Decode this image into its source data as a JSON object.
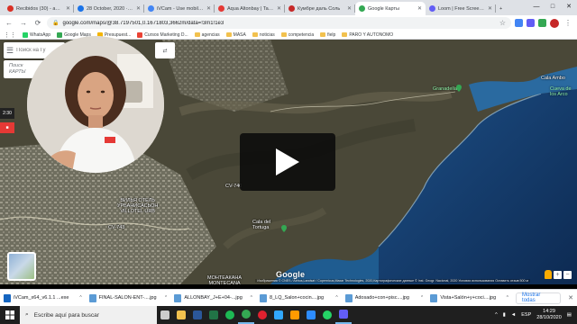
{
  "browser": {
    "tabs": [
      {
        "title": "Recibidos (30) - ama@",
        "color": "#d93025"
      },
      {
        "title": "28 October, 2020 · Lo",
        "color": "#1a73e8"
      },
      {
        "title": "iVCam - Use mobile p",
        "color": "#4285f4"
      },
      {
        "title": "Aqua Altonbay | Tarre",
        "color": "#e53935"
      },
      {
        "title": "Кумбре даль Соль",
        "color": "#c62828"
      },
      {
        "title": "Google Карты",
        "color": "#34a853"
      },
      {
        "title": "Loom | Free Screen &",
        "color": "#625df5"
      }
    ],
    "active_tab": 5,
    "window_controls": [
      "—",
      "□",
      "✕"
    ],
    "url": "google.com/maps/@38.7197501,0.1671803,3662m/data=!3m1!1e3",
    "bookmarks": [
      {
        "label": "WhatsApp",
        "color": "#25d366",
        "kind": "site"
      },
      {
        "label": "Google Maps",
        "color": "#34a853",
        "kind": "site"
      },
      {
        "label": "Presupuest...",
        "color": "#f4b400",
        "kind": "site"
      },
      {
        "label": "Cursos Marketing D...",
        "color": "#ea4335",
        "kind": "site"
      },
      {
        "label": "agencias",
        "kind": "folder"
      },
      {
        "label": "MASA",
        "kind": "folder"
      },
      {
        "label": "noticias",
        "kind": "folder"
      },
      {
        "label": "competencia",
        "kind": "folder"
      },
      {
        "label": "fielp",
        "kind": "folder"
      },
      {
        "label": "PARO Y AUTONOMO",
        "kind": "folder"
      }
    ]
  },
  "maps": {
    "search_placeholder": "Поиск на Гу",
    "search2_text": "Поиск\nКАРТЫ",
    "side_time": "2:30",
    "labels": [
      {
        "text": "Granadella",
        "kind": "green"
      },
      {
        "text": "Cala Ambo",
        "kind": "white"
      },
      {
        "text": "Cueva de\nlos Arco",
        "kind": "green"
      },
      {
        "text": "ВИЛЬЯ ОТЕЛЬ\nУРБАНИСАСЬОН\nVILLOTEL URB",
        "kind": "white"
      },
      {
        "text": "МОНТЕАКАНА\nMONTECANA",
        "kind": "white"
      },
      {
        "text": "Cala del\nTortuga",
        "kind": "white"
      },
      {
        "text": "CV-743",
        "kind": "white"
      },
      {
        "text": "CV-740",
        "kind": "white"
      }
    ],
    "logo_text": "Google",
    "credits": "Изображения © CNES / Airbus,Landsat / Copernicus,Maxar Technologies, 2020,Картографические данные © Inst. Geogr. Nacional, 2020   Условия использования   Оставить отзыв   500 м",
    "zoom_in": "+",
    "zoom_out": "−"
  },
  "downloads": {
    "items": [
      {
        "name": "iVCam_x64_v6.1.1 ...exe",
        "color": "#1565c0"
      },
      {
        "name": "FINAL-SALON-ENT-....jpg",
        "color": "#5b9bd5"
      },
      {
        "name": "ALLONBAY_J+E+04-...jpg",
        "color": "#5b9bd5"
      },
      {
        "name": "8_LQ_Salon+cocin....jpg",
        "color": "#5b9bd5"
      },
      {
        "name": "Adosado+con+pisc....jpg",
        "color": "#5b9bd5"
      },
      {
        "name": "Vista+Salón+y+coci....jpg",
        "color": "#5b9bd5"
      }
    ],
    "show_all": "Mostrar todas"
  },
  "taskbar": {
    "search_placeholder": "Escribe aquí para buscar",
    "apps": [
      {
        "name": "task-view",
        "color": "#cccccc"
      },
      {
        "name": "file-explorer",
        "color": "#f2c14e"
      },
      {
        "name": "word",
        "color": "#2b579a"
      },
      {
        "name": "excel",
        "color": "#217346"
      },
      {
        "name": "spotify",
        "color": "#1db954"
      },
      {
        "name": "chrome",
        "color": "#34a853"
      },
      {
        "name": "opera",
        "color": "#e0212f"
      },
      {
        "name": "photoshop",
        "color": "#31a8ff"
      },
      {
        "name": "illustrator",
        "color": "#ff9a00"
      },
      {
        "name": "zoom",
        "color": "#2d8cff"
      },
      {
        "name": "whatsapp",
        "color": "#25d366"
      },
      {
        "name": "loom",
        "color": "#625df5"
      }
    ],
    "lang": "ESP",
    "time": "14:29",
    "date": "28/10/2020"
  }
}
